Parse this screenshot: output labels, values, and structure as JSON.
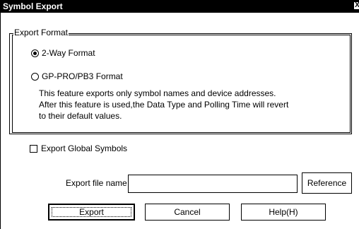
{
  "window": {
    "title": "Symbol Export",
    "close_glyph": "X"
  },
  "export_format": {
    "legend": "Export Format",
    "options": [
      {
        "label": "2-Way Format",
        "selected": true
      },
      {
        "label": "GP-PRO/PB3 Format",
        "selected": false
      }
    ],
    "description_lines": [
      "This feature exports only symbol names and device addresses.",
      "After this feature is used,the Data Type and Polling Time will revert",
      "to their default values."
    ]
  },
  "global_symbols": {
    "label": "Export Global Symbols",
    "checked": false
  },
  "file": {
    "label": "Export file name",
    "value": "",
    "reference_label": "Reference"
  },
  "buttons": {
    "export": "Export",
    "cancel": "Cancel",
    "help": "Help(H)"
  }
}
